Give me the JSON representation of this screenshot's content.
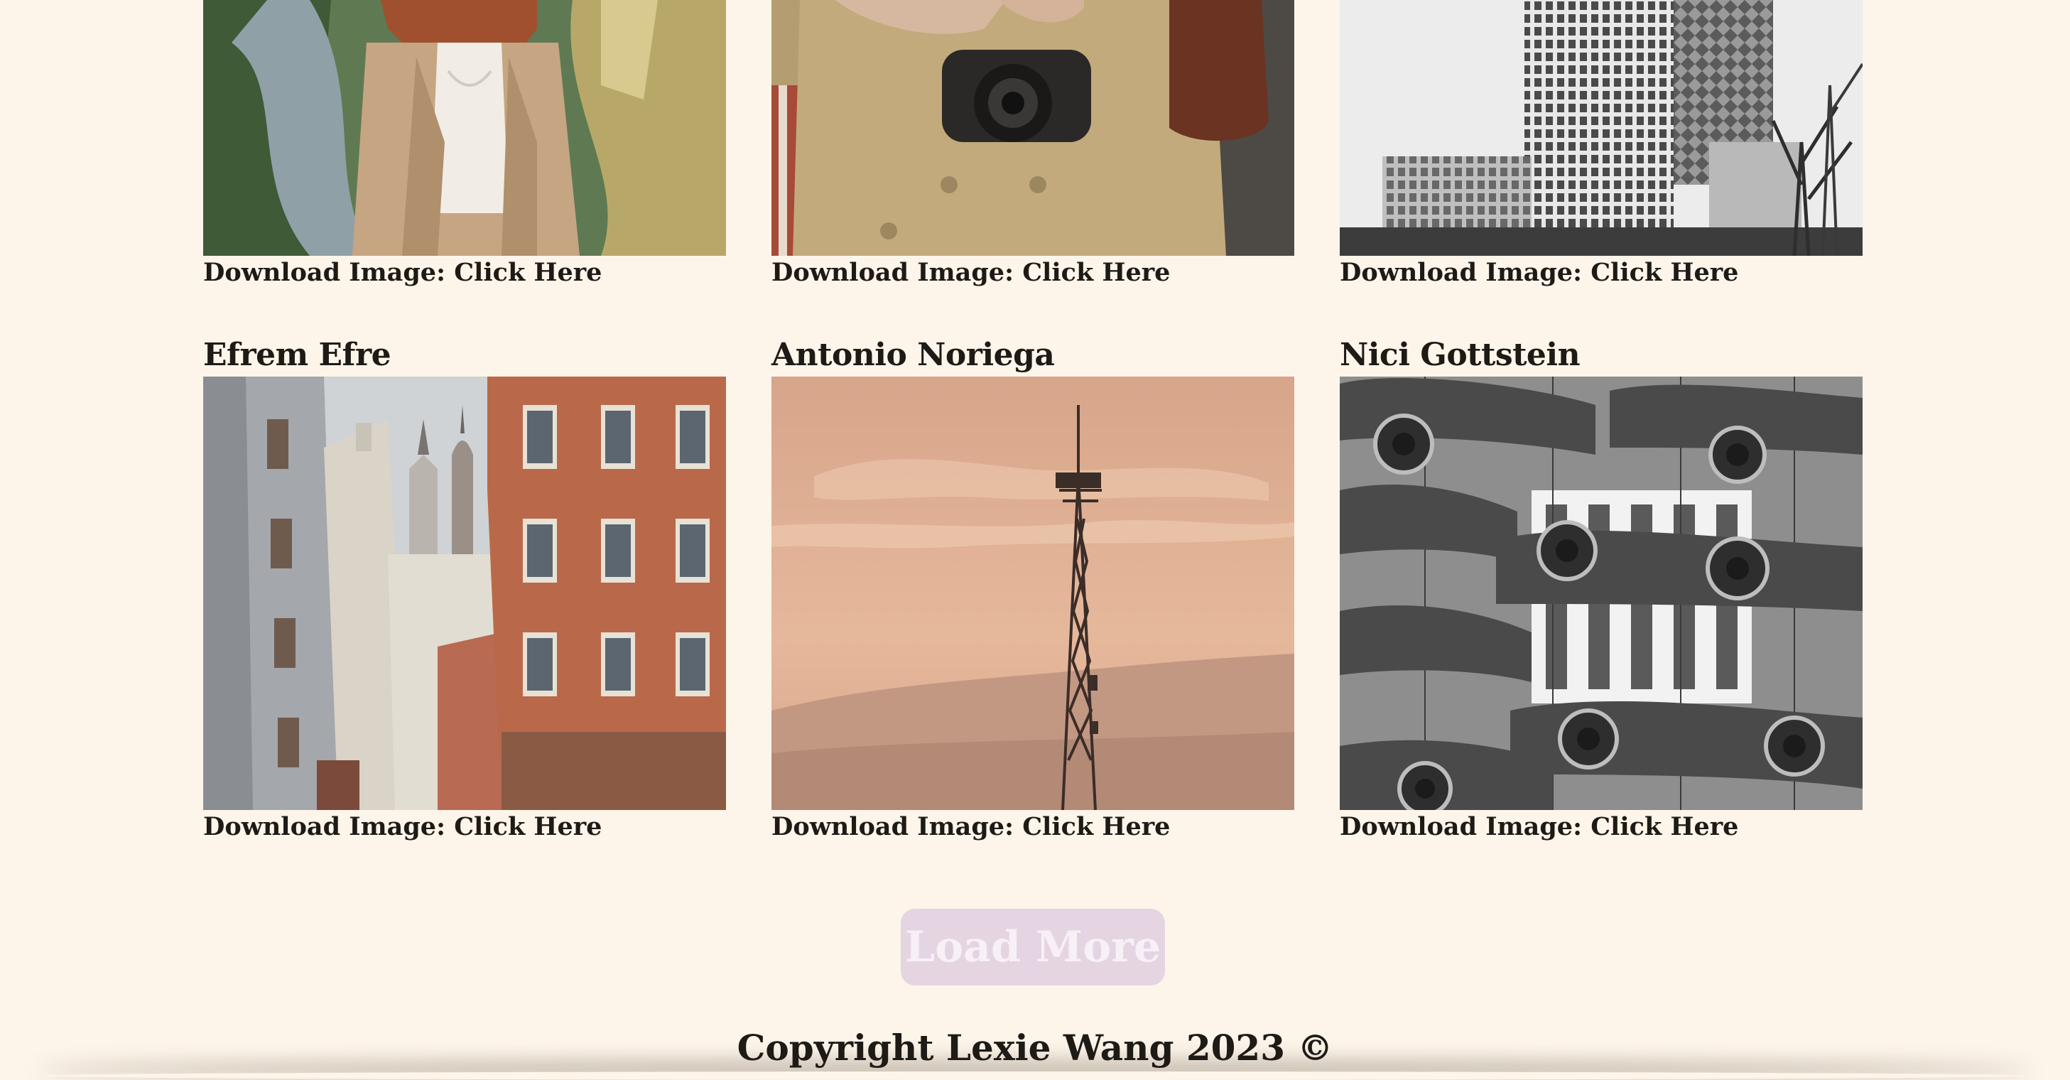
{
  "gallery": {
    "top_row": [
      {
        "download_prefix": "Download Image: ",
        "download_link": "Click Here"
      },
      {
        "download_prefix": "Download Image: ",
        "download_link": "Click Here"
      },
      {
        "download_prefix": "Download Image: ",
        "download_link": "Click Here"
      }
    ],
    "bottom_row": [
      {
        "author": "Efrem Efre",
        "download_prefix": "Download Image: ",
        "download_link": "Click Here"
      },
      {
        "author": "Antonio Noriega",
        "download_prefix": "Download Image: ",
        "download_link": "Click Here"
      },
      {
        "author": "Nici Gottstein",
        "download_prefix": "Download Image: ",
        "download_link": "Click Here"
      }
    ]
  },
  "load_more": {
    "label": "Load More",
    "color": "#e5d5e3"
  },
  "footer": {
    "copyright": "Copyright Lexie Wang 2023 ©"
  },
  "theme": {
    "background": "#fdf5ea",
    "text": "#1e1a16"
  }
}
